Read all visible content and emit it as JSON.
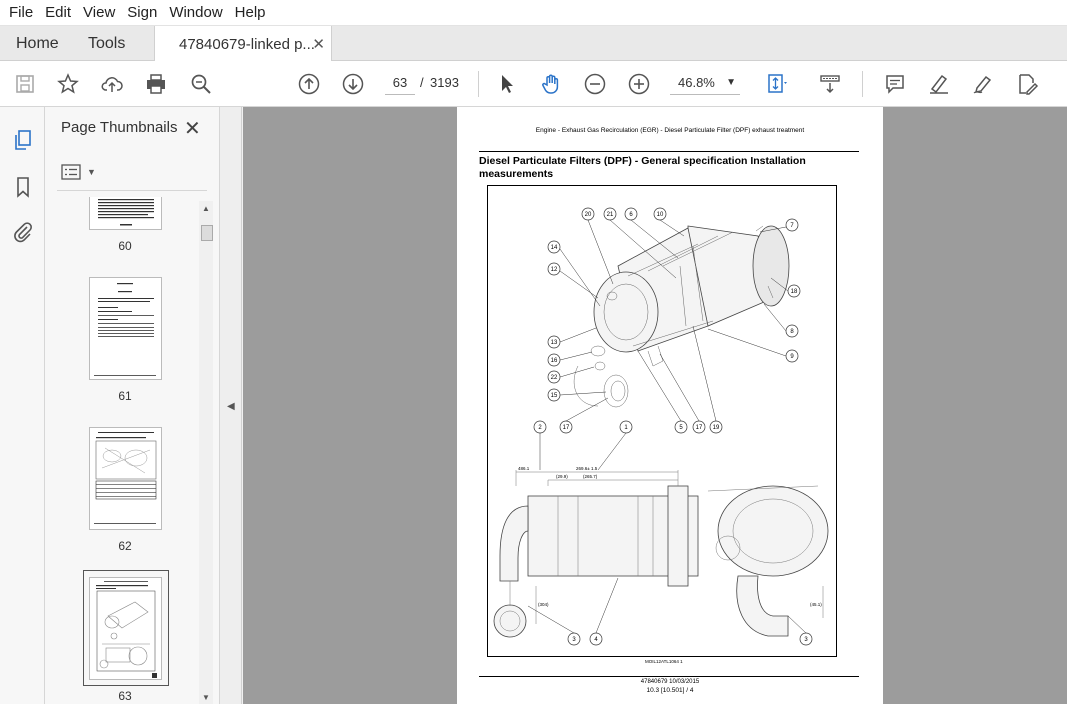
{
  "menu": [
    "File",
    "Edit",
    "View",
    "Sign",
    "Window",
    "Help"
  ],
  "tabs": {
    "home": "Home",
    "tools": "Tools",
    "document": "47840679-linked p...",
    "close": "✕"
  },
  "toolbar": {
    "current_page": "63",
    "page_sep": "/",
    "page_count": "3193",
    "zoom": "46.8%"
  },
  "thumbnails_panel": {
    "title": "Page Thumbnails",
    "close": "✕",
    "pages": [
      "60",
      "61",
      "62",
      "63"
    ]
  },
  "document": {
    "header": "Engine - Exhaust Gas Recirculation (EGR) - Diesel Particulate Filter (DPF) exhaust treatment",
    "title": "Diesel Particulate Filters (DPF) - General specification Installation measurements",
    "callouts": [
      "20",
      "21",
      "6",
      "10",
      "7",
      "14",
      "12",
      "18",
      "8",
      "9",
      "13",
      "16",
      "22",
      "15",
      "2",
      "17",
      "1",
      "5",
      "17",
      "19",
      "3",
      "4",
      "3"
    ],
    "dimensions": [
      "486.1",
      "269.6± 1.5",
      "(29.9)",
      "(265.7)",
      "(304)",
      "(45.1)"
    ],
    "figure_code": "MOIL12ATL1064   1",
    "footer_line1": "47840679 10/03/2015",
    "footer_line2": "10.3 [10.501] / 4"
  },
  "colors": {
    "accent": "#2b73c8",
    "doc_background": "#9c9c9c"
  }
}
